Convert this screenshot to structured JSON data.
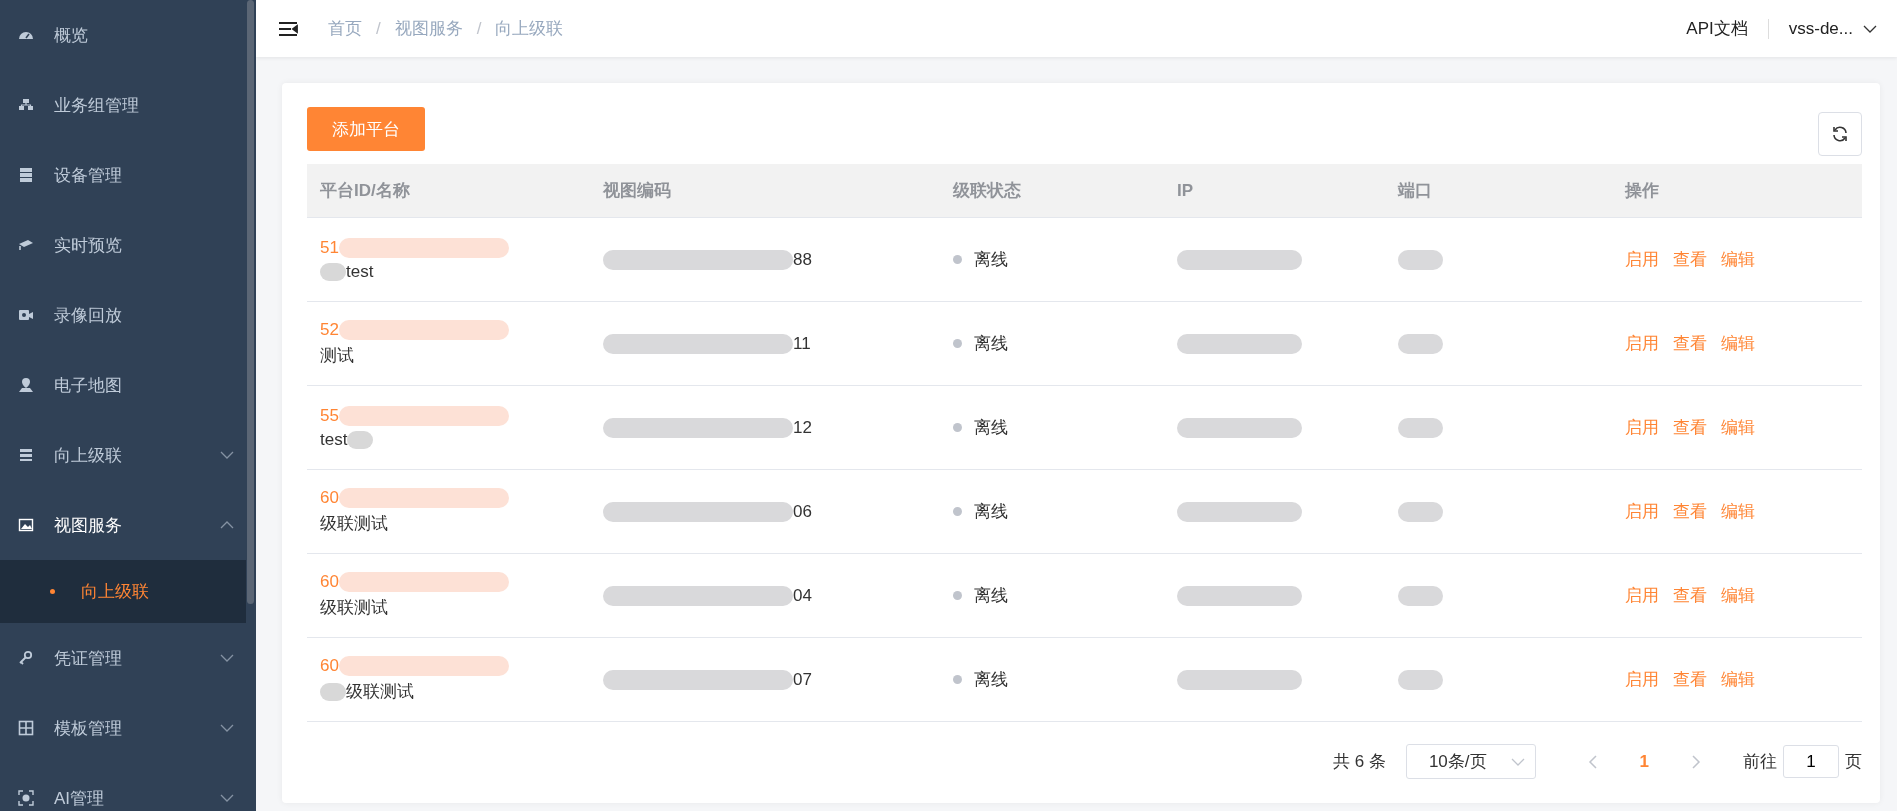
{
  "sidebar": {
    "items": [
      {
        "label": "概览",
        "kind": "link"
      },
      {
        "label": "业务组管理",
        "kind": "link"
      },
      {
        "label": "设备管理",
        "kind": "link"
      },
      {
        "label": "实时预览",
        "kind": "link"
      },
      {
        "label": "录像回放",
        "kind": "link"
      },
      {
        "label": "电子地图",
        "kind": "link"
      },
      {
        "label": "向上级联",
        "kind": "submenu",
        "expanded": false
      },
      {
        "label": "视图服务",
        "kind": "submenu",
        "expanded": true,
        "children": [
          {
            "label": "向上级联",
            "selected": true
          }
        ]
      },
      {
        "label": "凭证管理",
        "kind": "submenu",
        "expanded": false
      },
      {
        "label": "模板管理",
        "kind": "submenu",
        "expanded": false
      },
      {
        "label": "AI管理",
        "kind": "submenu",
        "expanded": false
      }
    ]
  },
  "header": {
    "breadcrumb": [
      "首页",
      "视图服务",
      "向上级联"
    ],
    "breadcrumb_separator": "/",
    "api_link": "API文档",
    "user": "vss-de..."
  },
  "toolbar": {
    "add_button": "添加平台"
  },
  "table": {
    "columns": [
      "平台ID/名称",
      "视图编码",
      "级联状态",
      "IP",
      "端口",
      "操作"
    ],
    "rows": [
      {
        "id": "51",
        "name": "test",
        "redacted_before": true,
        "redacted_after": false,
        "code": "88",
        "status": {
          "text": "离线",
          "color": "#c0c4cc"
        },
        "actions": [
          "启用",
          "查看",
          "编辑"
        ]
      },
      {
        "id": "52",
        "name": "测试",
        "redacted_before": false,
        "redacted_after": false,
        "code": "11",
        "status": {
          "text": "离线",
          "color": "#c0c4cc"
        },
        "actions": [
          "启用",
          "查看",
          "编辑"
        ]
      },
      {
        "id": "55",
        "name": "test",
        "redacted_before": false,
        "redacted_after": true,
        "code": "12",
        "status": {
          "text": "离线",
          "color": "#c0c4cc"
        },
        "actions": [
          "启用",
          "查看",
          "编辑"
        ]
      },
      {
        "id": "60",
        "name": "级联测试",
        "redacted_before": false,
        "redacted_after": false,
        "code": "06",
        "status": {
          "text": "离线",
          "color": "#c0c4cc"
        },
        "actions": [
          "启用",
          "查看",
          "编辑"
        ]
      },
      {
        "id": "60",
        "name": "级联测试",
        "redacted_before": false,
        "redacted_after": false,
        "code": "04",
        "status": {
          "text": "离线",
          "color": "#c0c4cc"
        },
        "actions": [
          "启用",
          "查看",
          "编辑"
        ]
      },
      {
        "id": "60",
        "name": "级联测试",
        "redacted_before": true,
        "redacted_after": false,
        "code": "07",
        "status": {
          "text": "离线",
          "color": "#c0c4cc"
        },
        "actions": [
          "启用",
          "查看",
          "编辑"
        ]
      }
    ]
  },
  "pagination": {
    "total": "共 6 条",
    "page_size": "10条/页",
    "pages": [
      {
        "label": "1",
        "selected": true
      }
    ],
    "goto_label": "前往",
    "goto_value": "1",
    "goto_suffix": "页"
  }
}
